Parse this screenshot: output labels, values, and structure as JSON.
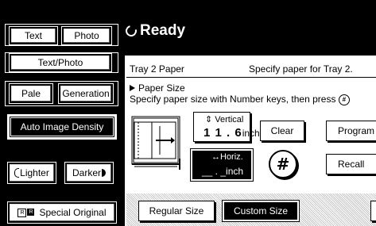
{
  "left": {
    "text": "Text",
    "photo": "Photo",
    "text_photo": "Text/Photo",
    "pale": "Pale",
    "generation": "Generation",
    "auto_density": "Auto Image Density",
    "lighter": "Lighter",
    "darker": "Darker",
    "special_original": "Special Original"
  },
  "header": {
    "status": "Ready"
  },
  "content": {
    "tray": "Tray 2 Paper",
    "specify": "Specify paper for Tray 2.",
    "paper_size": "Paper Size",
    "instruction": "Specify paper size with Number keys, then press",
    "vertical_label": "Vertical",
    "vertical_value": "1 1 . 6",
    "vertical_unit": "inch",
    "horiz_label": "Horiz.",
    "horiz_unit": "inch",
    "horiz_value": "__ . _",
    "clear": "Clear",
    "program": "Program",
    "recall": "Recall",
    "hash": "#",
    "regular_size": "Regular Size",
    "custom_size": "Custom Size"
  }
}
